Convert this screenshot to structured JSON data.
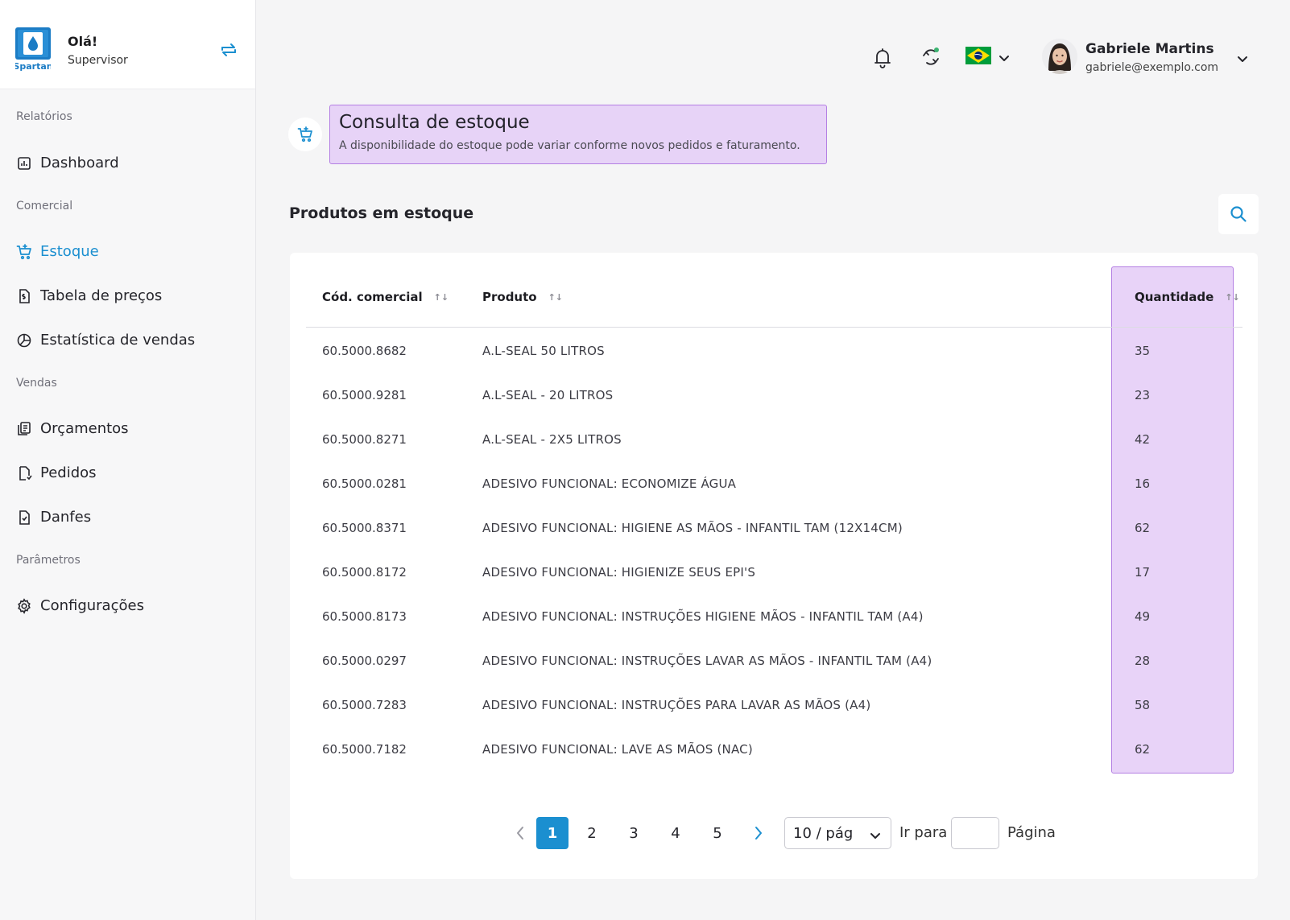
{
  "sidebar": {
    "brand": "Spartan",
    "greeting": "Olá!",
    "role": "Supervisor",
    "sections": {
      "reports": "Relatórios",
      "commercial": "Comercial",
      "sales": "Vendas",
      "parameters": "Parâmetros"
    },
    "items": {
      "dashboard": "Dashboard",
      "stock": "Estoque",
      "price_table": "Tabela de preços",
      "sales_stats": "Estatística de vendas",
      "quotes": "Orçamentos",
      "orders": "Pedidos",
      "danfes": "Danfes",
      "settings": "Configurações"
    },
    "active_item": "stock"
  },
  "topbar": {
    "icons": [
      "bell-icon",
      "sync-icon",
      "brazil-flag-icon",
      "chevron-down-icon"
    ],
    "user": {
      "name": "Gabriele Martins",
      "email": "gabriele@exemplo.com"
    }
  },
  "page": {
    "title": "Consulta de estoque",
    "subtitle": "A disponibilidade do estoque pode variar conforme novos pedidos e faturamento.",
    "section_title": "Produtos em estoque"
  },
  "table": {
    "headers": {
      "code": "Cód. comercial",
      "product": "Produto",
      "quantity": "Quantidade"
    },
    "sort_glyph": "↑↓",
    "rows": [
      {
        "code": "60.5000.8682",
        "product": "A.L-SEAL 50 LITROS",
        "qty": "35"
      },
      {
        "code": "60.5000.9281",
        "product": "A.L-SEAL - 20 LITROS",
        "qty": "23"
      },
      {
        "code": "60.5000.8271",
        "product": "A.L-SEAL - 2X5 LITROS",
        "qty": "42"
      },
      {
        "code": "60.5000.0281",
        "product": "ADESIVO FUNCIONAL: ECONOMIZE ÁGUA",
        "qty": "16"
      },
      {
        "code": "60.5000.8371",
        "product": "ADESIVO FUNCIONAL: HIGIENE AS MÃOS - INFANTIL TAM (12X14CM)",
        "qty": "62"
      },
      {
        "code": "60.5000.8172",
        "product": "ADESIVO FUNCIONAL: HIGIENIZE SEUS EPI'S",
        "qty": "17"
      },
      {
        "code": "60.5000.8173",
        "product": "ADESIVO FUNCIONAL: INSTRUÇÕES HIGIENE MÃOS - INFANTIL TAM (A4)",
        "qty": "49"
      },
      {
        "code": "60.5000.0297",
        "product": "ADESIVO FUNCIONAL: INSTRUÇÕES LAVAR AS MÃOS - INFANTIL TAM (A4)",
        "qty": "28"
      },
      {
        "code": "60.5000.7283",
        "product": "ADESIVO FUNCIONAL: INSTRUÇÕES PARA LAVAR AS MÃOS (A4)",
        "qty": "58"
      },
      {
        "code": "60.5000.7182",
        "product": "ADESIVO FUNCIONAL: LAVE AS MÃOS (NAC)",
        "qty": "62"
      }
    ]
  },
  "pagination": {
    "pages": [
      "1",
      "2",
      "3",
      "4",
      "5"
    ],
    "current": "1",
    "per_page": "10 / pág",
    "goto_label": "Ir para",
    "goto_value": "",
    "page_label": "Página"
  },
  "colors": {
    "accent": "#1b8fd0",
    "highlight_fill": "#e7d3f7",
    "highlight_border": "#b47fe3"
  }
}
